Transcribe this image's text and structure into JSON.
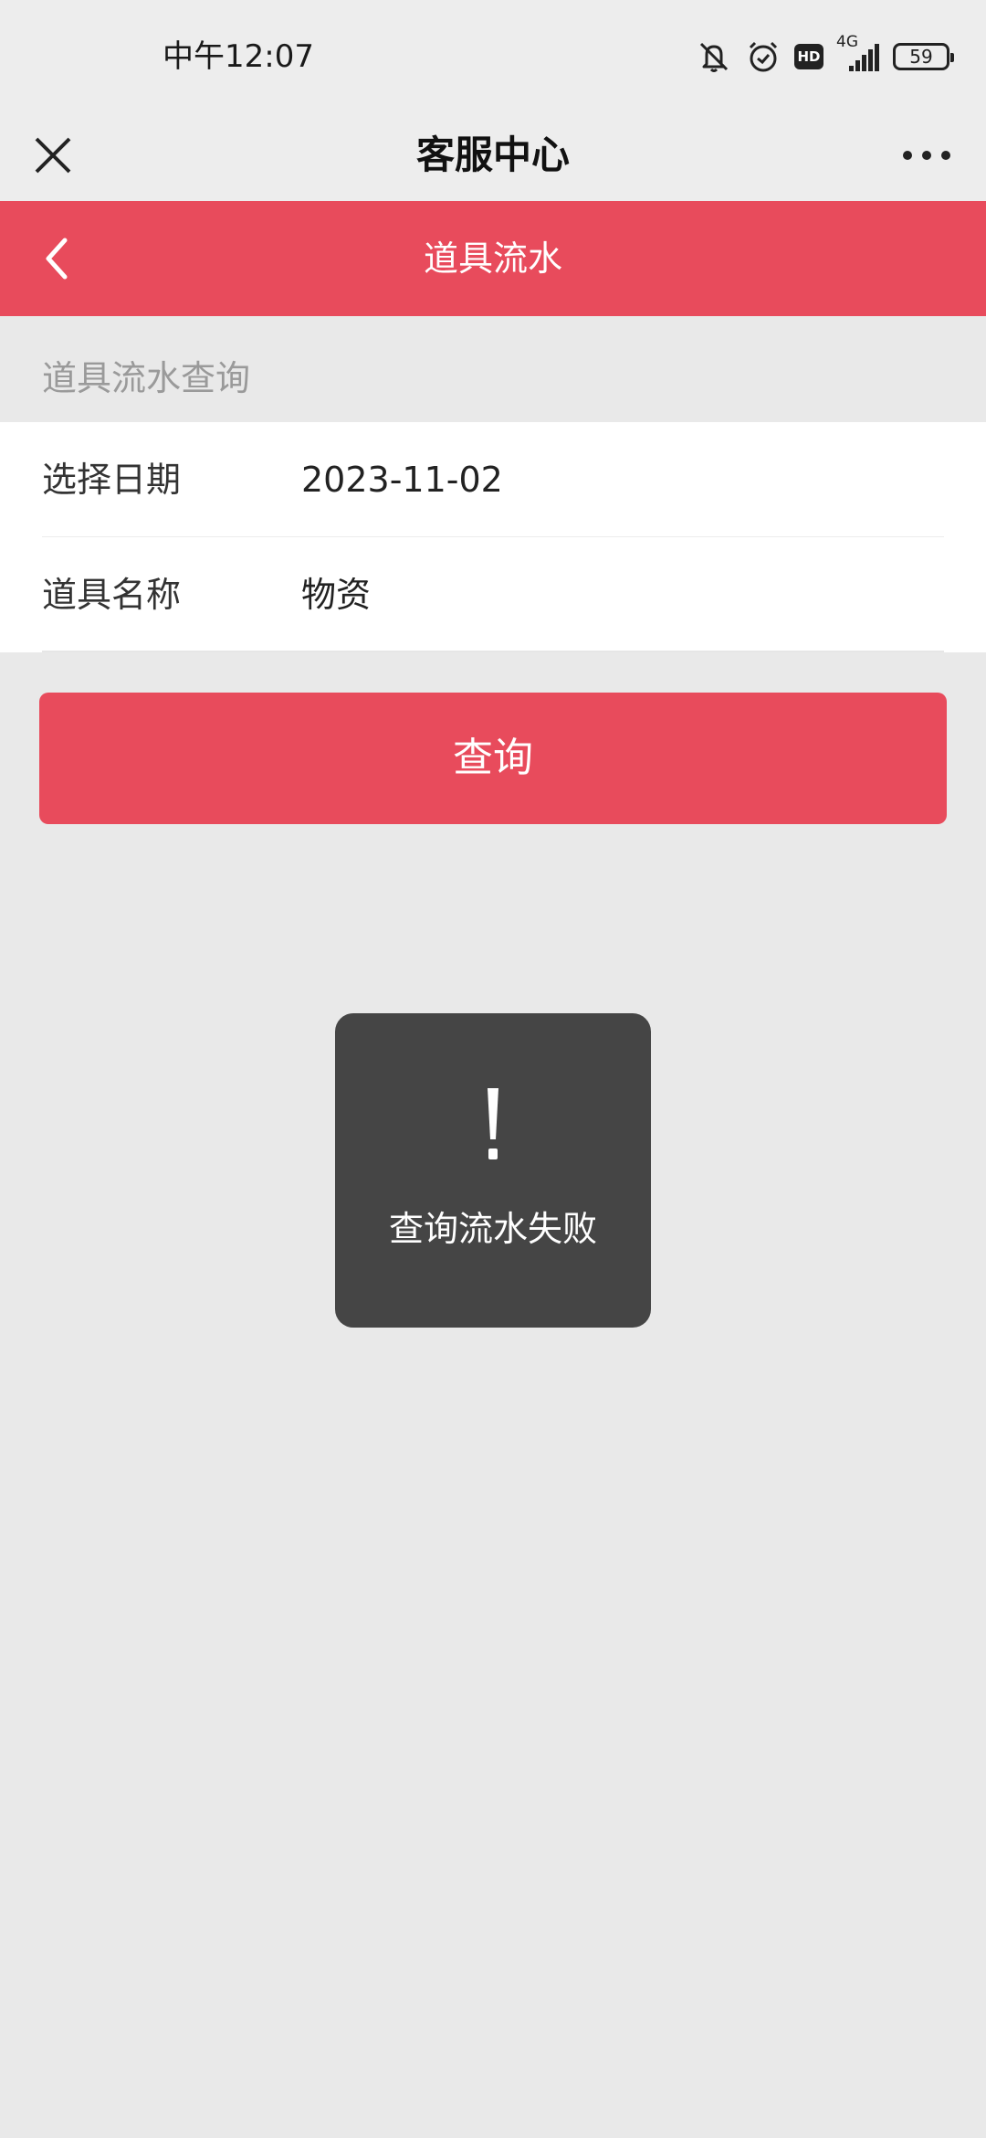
{
  "status_bar": {
    "time": "中午12:07",
    "hd_badge": "HD",
    "network": "4G",
    "battery": "59"
  },
  "title_bar": {
    "title": "客服中心",
    "icons": [
      "close-icon",
      "more-icon"
    ]
  },
  "page_header": {
    "title": "道具流水",
    "back_icon": "chevron-left-icon",
    "color": "#e84b5c"
  },
  "section": {
    "label": "道具流水查询"
  },
  "form": {
    "rows": [
      {
        "label": "选择日期",
        "value": "2023-11-02"
      },
      {
        "label": "道具名称",
        "value": "物资"
      }
    ]
  },
  "query_button": {
    "label": "查询",
    "color": "#e84b5c"
  },
  "toast": {
    "icon": "exclamation-icon",
    "message": "查询流水失败"
  }
}
